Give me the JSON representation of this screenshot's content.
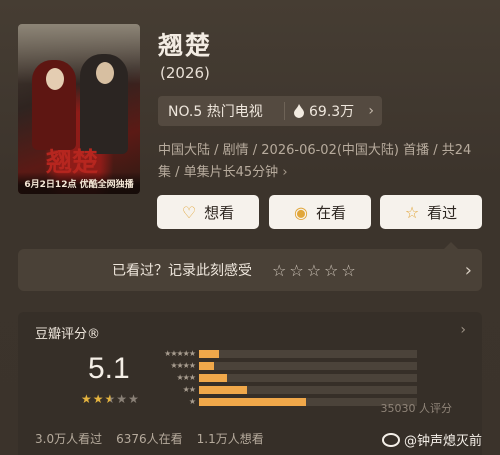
{
  "poster": {
    "band_text": "6月2日12点  优酷全网独播",
    "calligraphy": "翘楚"
  },
  "title": "翘楚",
  "year": "(2026)",
  "rank": {
    "label": "NO.5 热门电视",
    "heat": "69.3万"
  },
  "meta_text": "中国大陆 / 剧情 / 2026-06-02(中国大陆) 首播 / 共24集 / 单集片长45分钟",
  "buttons": {
    "want": "想看",
    "watching": "在看",
    "watched": "看过"
  },
  "seen_prompt": {
    "text": "已看过？记录此刻感受",
    "stars": "☆☆☆☆☆"
  },
  "rating": {
    "header": "豆瓣评分®",
    "score": "5.1",
    "score_stars": 2.5,
    "distribution": [
      {
        "stars": "★★★★★",
        "percent": 9
      },
      {
        "stars": "★★★★",
        "percent": 7
      },
      {
        "stars": "★★★",
        "percent": 13
      },
      {
        "stars": "★★",
        "percent": 22
      },
      {
        "stars": "★",
        "percent": 49
      }
    ],
    "count_text": "35030 人评分"
  },
  "stats": {
    "watched": "3.0万人看过",
    "watching": "6376人在看",
    "want": "1.1万人想看"
  },
  "watermark": "@钟声熄灭前",
  "colors": {
    "accent": "#f0a84a",
    "star": "#e5b43f",
    "background": "#3f372f"
  }
}
